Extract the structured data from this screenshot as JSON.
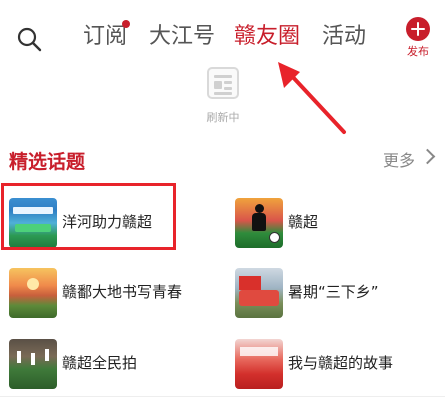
{
  "nav": {
    "tabs": [
      {
        "label": "订阅",
        "has_dot": true
      },
      {
        "label": "大江号"
      },
      {
        "label": "赣友圈",
        "active": true
      },
      {
        "label": "活动"
      }
    ],
    "publish_label": "发布",
    "accent_color": "#c81e2b"
  },
  "refresh": {
    "text": "刷新中"
  },
  "section": {
    "title": "精选话题",
    "more": "更多"
  },
  "topics": [
    {
      "label": "洋河助力赣超",
      "thumb": "green-banner-ad"
    },
    {
      "label": "赣超",
      "thumb": "soccer-player-silhouette"
    },
    {
      "label": "赣鄱大地书写青春",
      "thumb": "sunset-landscape"
    },
    {
      "label": "暑期“三下乡”",
      "thumb": "group-with-red-flag"
    },
    {
      "label": "赣超全民拍",
      "thumb": "stadium-crowd"
    },
    {
      "label": "我与赣超的故事",
      "thumb": "fans-with-red-banners"
    }
  ],
  "annotation_color": "#e8232a"
}
